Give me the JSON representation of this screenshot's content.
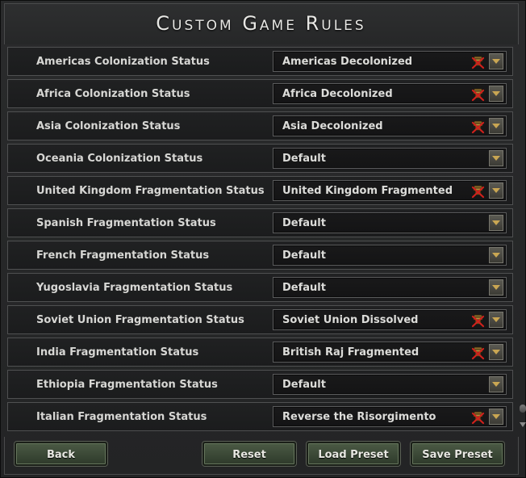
{
  "window": {
    "title": "Custom Game Rules"
  },
  "rules": [
    {
      "label": "Americas Colonization Status",
      "value": "Americas Decolonized",
      "ironman_warning": true
    },
    {
      "label": "Africa Colonization Status",
      "value": "Africa Decolonized",
      "ironman_warning": true
    },
    {
      "label": "Asia Colonization Status",
      "value": "Asia Decolonized",
      "ironman_warning": true
    },
    {
      "label": "Oceania Colonization Status",
      "value": "Default",
      "ironman_warning": false
    },
    {
      "label": "United Kingdom Fragmentation Status",
      "value": "United Kingdom Fragmented",
      "ironman_warning": true
    },
    {
      "label": "Spanish Fragmentation Status",
      "value": "Default",
      "ironman_warning": false
    },
    {
      "label": "French Fragmentation Status",
      "value": "Default",
      "ironman_warning": false
    },
    {
      "label": "Yugoslavia Fragmentation Status",
      "value": "Default",
      "ironman_warning": false
    },
    {
      "label": "Soviet Union Fragmentation Status",
      "value": "Soviet Union Dissolved",
      "ironman_warning": true
    },
    {
      "label": "India Fragmentation Status",
      "value": "British Raj Fragmented",
      "ironman_warning": true
    },
    {
      "label": "Ethiopia Fragmentation Status",
      "value": "Default",
      "ironman_warning": false
    },
    {
      "label": "Italian Fragmentation Status",
      "value": "Reverse the Risorgimento",
      "ironman_warning": true
    }
  ],
  "buttons": {
    "back": "Back",
    "reset": "Reset",
    "load_preset": "Load Preset",
    "save_preset": "Save Preset"
  },
  "colors": {
    "accent": "#c9a653",
    "button_green": "#3d4a37",
    "warning_red": "#c8201c"
  },
  "icons": {
    "warning": "ironman-disabled-icon",
    "dropdown": "dropdown-arrow-icon"
  }
}
